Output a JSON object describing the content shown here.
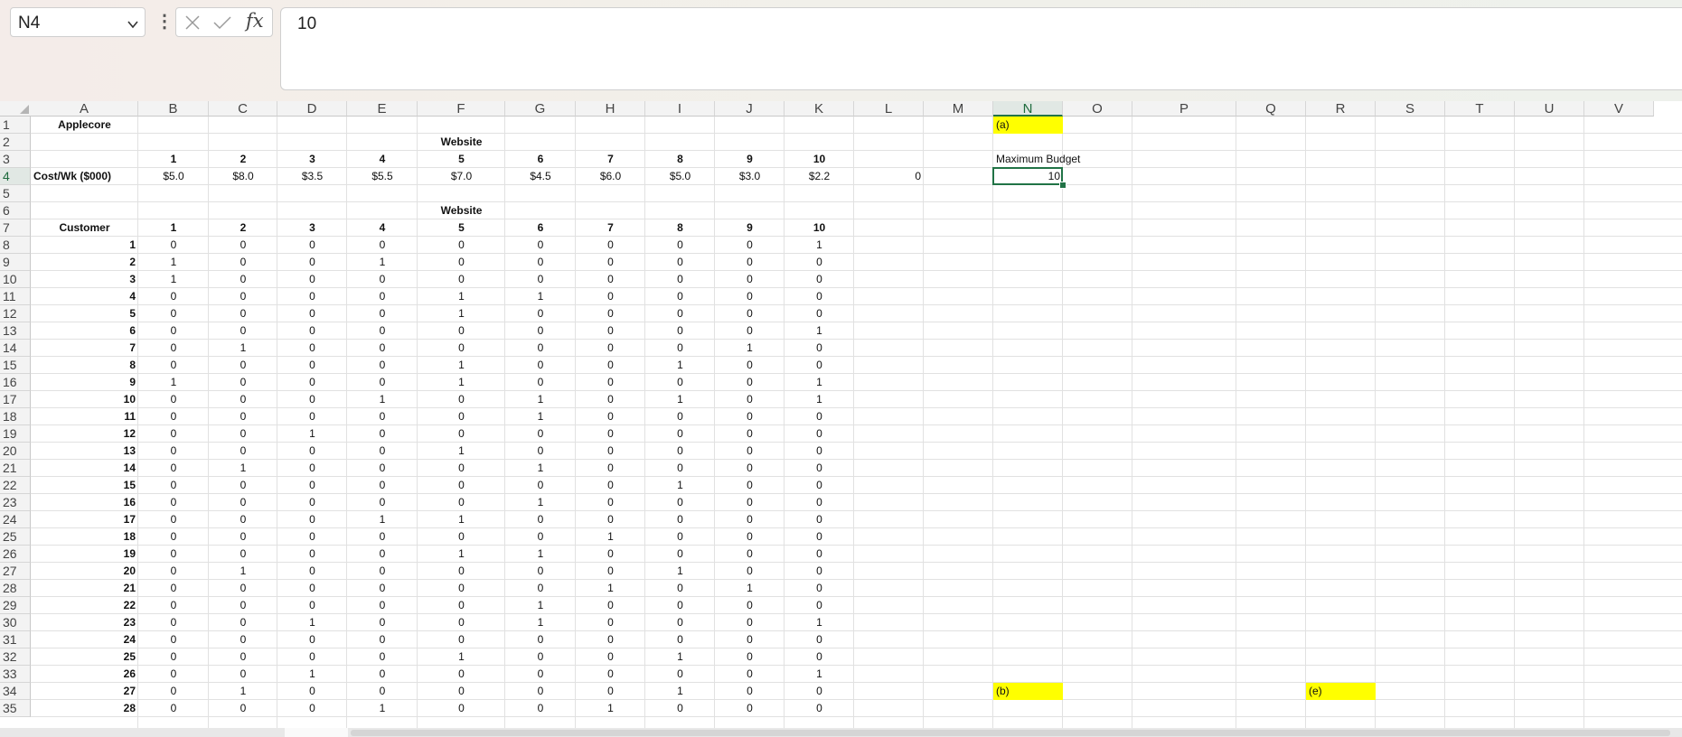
{
  "formula_bar": {
    "name_box": "N4",
    "formula": "10"
  },
  "columns": [
    "A",
    "B",
    "C",
    "D",
    "E",
    "F",
    "G",
    "H",
    "I",
    "J",
    "K",
    "L",
    "M",
    "N",
    "O",
    "P",
    "Q",
    "R",
    "S",
    "T",
    "U",
    "V"
  ],
  "rows": [
    "1",
    "2",
    "3",
    "4",
    "5",
    "6",
    "7",
    "8",
    "9",
    "10",
    "11",
    "12",
    "13",
    "14",
    "15",
    "16",
    "17",
    "18",
    "19",
    "20",
    "21",
    "22",
    "23",
    "24",
    "25",
    "26",
    "27",
    "28",
    "29",
    "30",
    "31",
    "32",
    "33",
    "34",
    "35"
  ],
  "sheet": {
    "title": "Applecore",
    "website_header_1": "Website",
    "website_header_2": "Website",
    "website_numbers": [
      "1",
      "2",
      "3",
      "4",
      "5",
      "6",
      "7",
      "8",
      "9",
      "10"
    ],
    "cost_label": "Cost/Wk ($000)",
    "costs": [
      "$5.0",
      "$8.0",
      "$3.5",
      "$5.5",
      "$7.0",
      "$4.5",
      "$6.0",
      "$5.0",
      "$3.0",
      "$2.2"
    ],
    "l4_value": "0",
    "customer_label": "Customer",
    "n1_label": "(a)",
    "n3_label": "Maximum Budget",
    "n4_value": "10",
    "n34_label": "(b)",
    "r34_label": "(e)",
    "customers": [
      {
        "id": "1",
        "v": [
          "0",
          "0",
          "0",
          "0",
          "0",
          "0",
          "0",
          "0",
          "0",
          "1"
        ]
      },
      {
        "id": "2",
        "v": [
          "1",
          "0",
          "0",
          "1",
          "0",
          "0",
          "0",
          "0",
          "0",
          "0"
        ]
      },
      {
        "id": "3",
        "v": [
          "1",
          "0",
          "0",
          "0",
          "0",
          "0",
          "0",
          "0",
          "0",
          "0"
        ]
      },
      {
        "id": "4",
        "v": [
          "0",
          "0",
          "0",
          "0",
          "1",
          "1",
          "0",
          "0",
          "0",
          "0"
        ]
      },
      {
        "id": "5",
        "v": [
          "0",
          "0",
          "0",
          "0",
          "1",
          "0",
          "0",
          "0",
          "0",
          "0"
        ]
      },
      {
        "id": "6",
        "v": [
          "0",
          "0",
          "0",
          "0",
          "0",
          "0",
          "0",
          "0",
          "0",
          "1"
        ]
      },
      {
        "id": "7",
        "v": [
          "0",
          "1",
          "0",
          "0",
          "0",
          "0",
          "0",
          "0",
          "1",
          "0"
        ]
      },
      {
        "id": "8",
        "v": [
          "0",
          "0",
          "0",
          "0",
          "1",
          "0",
          "0",
          "1",
          "0",
          "0"
        ]
      },
      {
        "id": "9",
        "v": [
          "1",
          "0",
          "0",
          "0",
          "1",
          "0",
          "0",
          "0",
          "0",
          "1"
        ]
      },
      {
        "id": "10",
        "v": [
          "0",
          "0",
          "0",
          "1",
          "0",
          "1",
          "0",
          "1",
          "0",
          "1"
        ]
      },
      {
        "id": "11",
        "v": [
          "0",
          "0",
          "0",
          "0",
          "0",
          "1",
          "0",
          "0",
          "0",
          "0"
        ]
      },
      {
        "id": "12",
        "v": [
          "0",
          "0",
          "1",
          "0",
          "0",
          "0",
          "0",
          "0",
          "0",
          "0"
        ]
      },
      {
        "id": "13",
        "v": [
          "0",
          "0",
          "0",
          "0",
          "1",
          "0",
          "0",
          "0",
          "0",
          "0"
        ]
      },
      {
        "id": "14",
        "v": [
          "0",
          "1",
          "0",
          "0",
          "0",
          "1",
          "0",
          "0",
          "0",
          "0"
        ]
      },
      {
        "id": "15",
        "v": [
          "0",
          "0",
          "0",
          "0",
          "0",
          "0",
          "0",
          "1",
          "0",
          "0"
        ]
      },
      {
        "id": "16",
        "v": [
          "0",
          "0",
          "0",
          "0",
          "0",
          "1",
          "0",
          "0",
          "0",
          "0"
        ]
      },
      {
        "id": "17",
        "v": [
          "0",
          "0",
          "0",
          "1",
          "1",
          "0",
          "0",
          "0",
          "0",
          "0"
        ]
      },
      {
        "id": "18",
        "v": [
          "0",
          "0",
          "0",
          "0",
          "0",
          "0",
          "1",
          "0",
          "0",
          "0"
        ]
      },
      {
        "id": "19",
        "v": [
          "0",
          "0",
          "0",
          "0",
          "1",
          "1",
          "0",
          "0",
          "0",
          "0"
        ]
      },
      {
        "id": "20",
        "v": [
          "0",
          "1",
          "0",
          "0",
          "0",
          "0",
          "0",
          "1",
          "0",
          "0"
        ]
      },
      {
        "id": "21",
        "v": [
          "0",
          "0",
          "0",
          "0",
          "0",
          "0",
          "1",
          "0",
          "1",
          "0"
        ]
      },
      {
        "id": "22",
        "v": [
          "0",
          "0",
          "0",
          "0",
          "0",
          "1",
          "0",
          "0",
          "0",
          "0"
        ]
      },
      {
        "id": "23",
        "v": [
          "0",
          "0",
          "1",
          "0",
          "0",
          "1",
          "0",
          "0",
          "0",
          "1"
        ]
      },
      {
        "id": "24",
        "v": [
          "0",
          "0",
          "0",
          "0",
          "0",
          "0",
          "0",
          "0",
          "0",
          "0"
        ]
      },
      {
        "id": "25",
        "v": [
          "0",
          "0",
          "0",
          "0",
          "1",
          "0",
          "0",
          "1",
          "0",
          "0"
        ]
      },
      {
        "id": "26",
        "v": [
          "0",
          "0",
          "1",
          "0",
          "0",
          "0",
          "0",
          "0",
          "0",
          "1"
        ]
      },
      {
        "id": "27",
        "v": [
          "0",
          "1",
          "0",
          "0",
          "0",
          "0",
          "0",
          "1",
          "0",
          "0"
        ]
      },
      {
        "id": "28",
        "v": [
          "0",
          "0",
          "0",
          "1",
          "0",
          "0",
          "1",
          "0",
          "0",
          "0"
        ]
      }
    ]
  }
}
